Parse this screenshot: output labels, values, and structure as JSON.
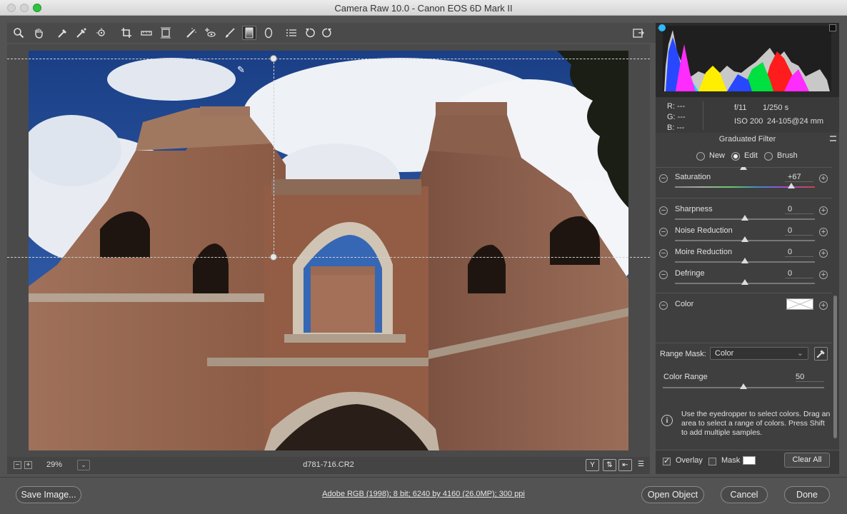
{
  "window": {
    "title": "Camera Raw 10.0  -  Canon EOS 6D Mark II"
  },
  "toolbar": {
    "tools": [
      "zoom-tool",
      "hand-tool",
      "white-balance-tool",
      "color-sampler-tool",
      "targeted-adjustment-tool",
      "crop-tool",
      "straighten-tool",
      "transform-tool",
      "spot-removal-tool",
      "red-eye-removal-tool",
      "adjustment-brush-tool",
      "graduated-filter-tool",
      "radial-filter-tool",
      "presets-list",
      "rotate-ccw",
      "rotate-cw"
    ],
    "active_tool": "graduated-filter-tool"
  },
  "canvas": {
    "zoom": "29%",
    "filename": "d781-716.CR2",
    "view_buttons": [
      "Y",
      "before-after",
      "swap",
      "settings"
    ]
  },
  "info": {
    "r": "R:  ---",
    "g": "G:  ---",
    "b": "B:  ---",
    "aperture": "f/11",
    "shutter": "1/250 s",
    "iso": "ISO 200",
    "lens": "24-105@24 mm"
  },
  "panel": {
    "title": "Graduated Filter",
    "modes": [
      {
        "label": "New",
        "selected": false
      },
      {
        "label": "Edit",
        "selected": true
      },
      {
        "label": "Brush",
        "selected": false
      }
    ],
    "sliders": [
      {
        "label": "Saturation",
        "value": "+67",
        "pos": 0.83
      },
      {
        "label": "Sharpness",
        "value": "0",
        "pos": 0.5
      },
      {
        "label": "Noise Reduction",
        "value": "0",
        "pos": 0.5
      },
      {
        "label": "Moire Reduction",
        "value": "0",
        "pos": 0.5
      },
      {
        "label": "Defringe",
        "value": "0",
        "pos": 0.5
      }
    ],
    "color_label": "Color",
    "range_mask_label": "Range Mask:",
    "range_mask_value": "Color",
    "color_range_label": "Color Range",
    "color_range_value": "50",
    "color_range_pos": 0.5,
    "hint": "Use the eyedropper to select colors. Drag an area to select a range of colors. Press Shift to add multiple samples.",
    "overlay_label": "Overlay",
    "overlay_checked": true,
    "mask_label": "Mask",
    "mask_checked": false,
    "clear_all": "Clear All"
  },
  "footer": {
    "save_image": "Save Image...",
    "workflow": "Adobe RGB (1998); 8 bit; 6240 by 4160 (26.0MP); 300 ppi",
    "open_object": "Open Object",
    "cancel": "Cancel",
    "done": "Done"
  }
}
